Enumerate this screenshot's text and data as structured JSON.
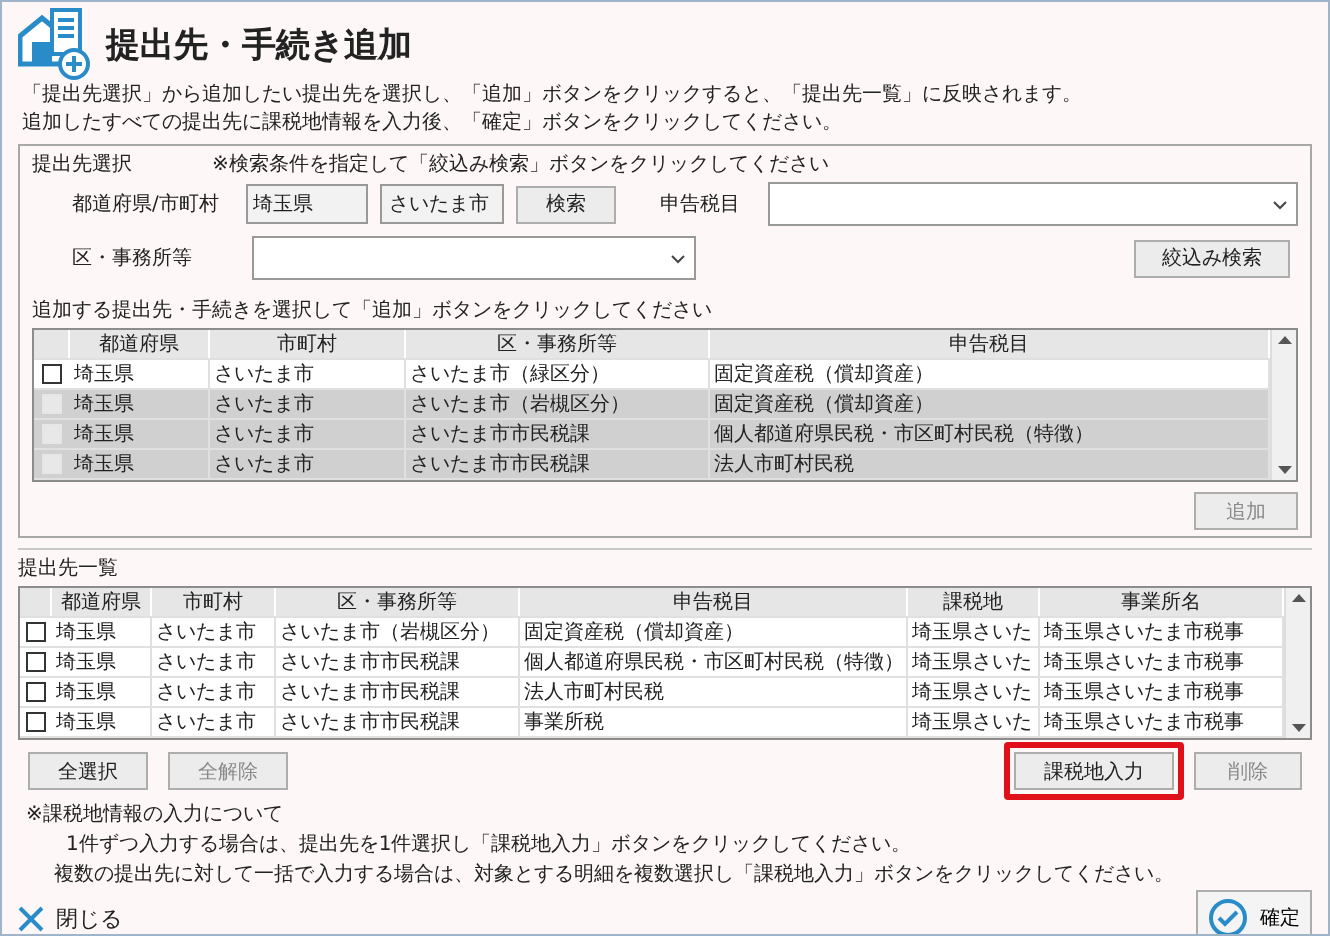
{
  "title": "提出先・手続き追加",
  "instructions": [
    "「提出先選択」から追加したい提出先を選択し、「追加」ボタンをクリックすると、「提出先一覧」に反映されます。",
    "追加したすべての提出先に課税地情報を入力後、「確定」ボタンをクリックしてください。"
  ],
  "selection_group": {
    "label": "提出先選択",
    "hint": "※検索条件を指定して「絞込み検索」ボタンをクリックしてください",
    "prefecture_city_label": "都道府県/市町村",
    "prefecture_value": "埼玉県",
    "city_value": "さいたま市",
    "search_button": "検索",
    "tax_item_label": "申告税目",
    "ward_label": "区・事務所等",
    "filter_button": "絞込み検索",
    "table_caption": "追加する提出先・手続きを選択して「追加」ボタンをクリックしてください",
    "table": {
      "columns": [
        "都道府県",
        "市町村",
        "区・事務所等",
        "申告税目"
      ],
      "rows": [
        {
          "checked": false,
          "disabled": false,
          "cells": [
            "埼玉県",
            "さいたま市",
            "さいたま市（緑区分）",
            "固定資産税（償却資産）"
          ]
        },
        {
          "checked": false,
          "disabled": true,
          "cells": [
            "埼玉県",
            "さいたま市",
            "さいたま市（岩槻区分）",
            "固定資産税（償却資産）"
          ]
        },
        {
          "checked": false,
          "disabled": true,
          "cells": [
            "埼玉県",
            "さいたま市",
            "さいたま市市民税課",
            "個人都道府県民税・市区町村民税（特徴）"
          ]
        },
        {
          "checked": false,
          "disabled": true,
          "cells": [
            "埼玉県",
            "さいたま市",
            "さいたま市市民税課",
            "法人市町村民税"
          ]
        }
      ]
    },
    "add_button": {
      "label": "追加",
      "disabled": true
    }
  },
  "list_group": {
    "label": "提出先一覧",
    "table": {
      "columns": [
        "都道府県",
        "市町村",
        "区・事務所等",
        "申告税目",
        "課税地",
        "事業所名"
      ],
      "rows": [
        {
          "checked": false,
          "cells": [
            "埼玉県",
            "さいたま市",
            "さいたま市（岩槻区分）",
            "固定資産税（償却資産）",
            "埼玉県さいた",
            "埼玉県さいたま市税事"
          ]
        },
        {
          "checked": false,
          "cells": [
            "埼玉県",
            "さいたま市",
            "さいたま市市民税課",
            "個人都道府県民税・市区町村民税（特徴）",
            "埼玉県さいた",
            "埼玉県さいたま市税事"
          ]
        },
        {
          "checked": false,
          "cells": [
            "埼玉県",
            "さいたま市",
            "さいたま市市民税課",
            "法人市町村民税",
            "埼玉県さいた",
            "埼玉県さいたま市税事"
          ]
        },
        {
          "checked": false,
          "cells": [
            "埼玉県",
            "さいたま市",
            "さいたま市市民税課",
            "事業所税",
            "埼玉県さいた",
            "埼玉県さいたま市税事"
          ]
        }
      ]
    },
    "left_buttons": [
      {
        "label": "全選択",
        "disabled": false,
        "highlighted": false
      },
      {
        "label": "全解除",
        "disabled": true,
        "highlighted": false
      }
    ],
    "right_buttons": [
      {
        "label": "課税地入力",
        "disabled": false,
        "highlighted": true
      },
      {
        "label": "削除",
        "disabled": true,
        "highlighted": false
      }
    ]
  },
  "note": {
    "title": "※課税地情報の入力について",
    "lines": [
      "1件ずつ入力する場合は、提出先を1件選択し「課税地入力」ボタンをクリックしてください。",
      "複数の提出先に対して一括で入力する場合は、対象とする明細を複数選択し「課税地入力」ボタンをクリックしてください。"
    ]
  },
  "close_button": "閉じる",
  "confirm_button": "確定"
}
